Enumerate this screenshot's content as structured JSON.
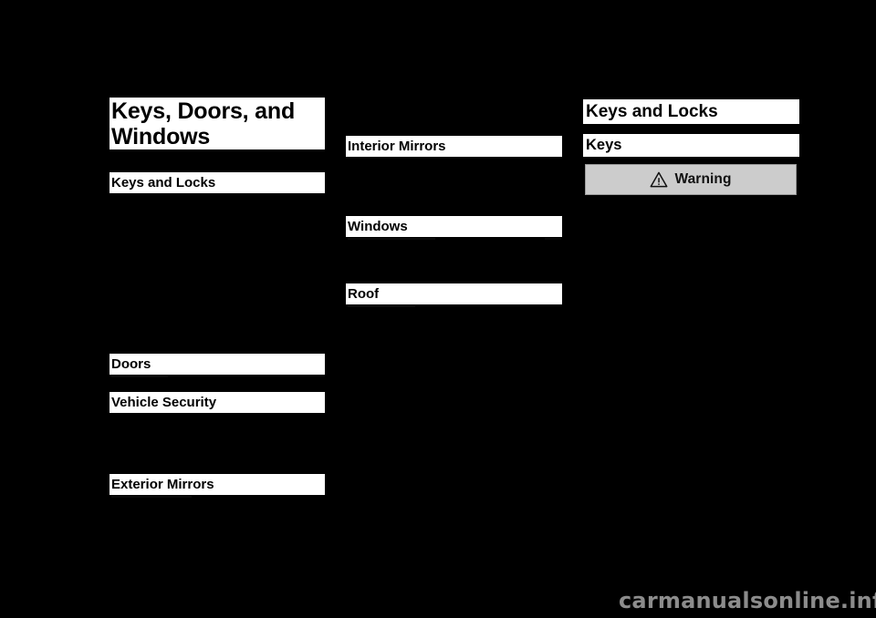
{
  "page": {
    "background_color": "#000000",
    "text_color": "#000000",
    "highlight_color": "#ffffff"
  },
  "chapter": {
    "title_line_1": "Keys, Doors, and",
    "title_line_2": "Windows"
  },
  "columns": {
    "left": {
      "sections": [
        {
          "label": "Keys and Locks"
        },
        {
          "label": "Doors"
        },
        {
          "label": "Vehicle Security"
        },
        {
          "label": "Exterior Mirrors"
        }
      ]
    },
    "middle": {
      "sections": [
        {
          "label": "Interior Mirrors"
        },
        {
          "label": "Windows"
        },
        {
          "label": "Roof"
        }
      ]
    },
    "right": {
      "heading": "Keys and Locks",
      "subheading": "Keys",
      "warning": {
        "label": "Warning",
        "icon": "warning-triangle-icon",
        "background_color": "#cccccc",
        "border_color": "#9a9a9a"
      }
    }
  },
  "footer": {
    "watermark": "carmanualsonline.info",
    "watermark_color": "#8c8c8c"
  }
}
